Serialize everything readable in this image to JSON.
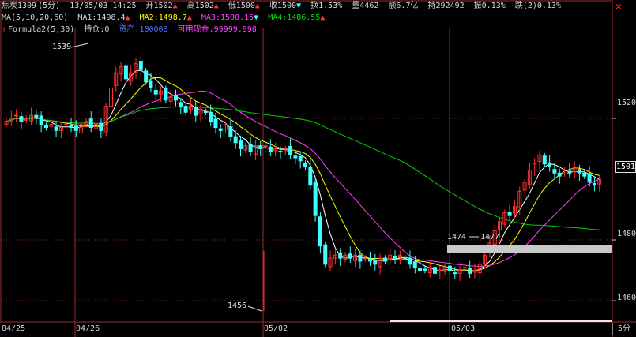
{
  "header": {
    "symbol": "焦炭1309",
    "period": "(5分)",
    "datetime": "13/05/03 14:25",
    "open": "开1502",
    "high": "高1502",
    "low": "低1500",
    "close": "收1500",
    "turnover_rate": "换1.53%",
    "volume": "量4462",
    "amount": "额6.7亿",
    "open_interest": "持292492",
    "amplitude": "振0.13%",
    "change": "跌(2)0.13%"
  },
  "ma_row": {
    "label": "MA(5,10,20,60)",
    "ma1": "MA1:1498.4",
    "ma2": "MA2:1498.7",
    "ma3": "MA3:1500.15",
    "ma4": "MA4:1486.55"
  },
  "formula_row": {
    "label": "Formula2(5,30)",
    "position": "持仓:0",
    "assets": "资产:100000",
    "cash": "可用现金:99999.998"
  },
  "y_axis": {
    "labels": [
      "1520",
      "1480",
      "1460"
    ],
    "current": "1501"
  },
  "x_axis": {
    "labels": [
      "04/25",
      "04/26",
      "05/02",
      "05/03"
    ],
    "period_button": "5分"
  },
  "annotations": {
    "high": "1539",
    "low": "1456",
    "level_a": "1474",
    "level_b": "1477"
  },
  "colors": {
    "up": "#ff3030",
    "down": "#40ffff",
    "ma5": "#ffffff",
    "ma10": "#ffff00",
    "ma20": "#ff40ff",
    "ma60": "#00d000",
    "grid": "#9b2b2b"
  },
  "chart_data": {
    "type": "line",
    "x_axis_labels": [
      "04/25",
      "04/26",
      "05/02",
      "05/03"
    ],
    "y_axis_ticks": [
      1520,
      1480,
      1460
    ],
    "ylim": [
      1453,
      1547
    ],
    "series": [
      {
        "name": "MA1",
        "last": 1498.4
      },
      {
        "name": "MA2",
        "last": 1498.7
      },
      {
        "name": "MA3",
        "last": 1500.15
      },
      {
        "name": "MA4",
        "last": 1486.55
      }
    ],
    "ohlc_close": [
      1519,
      1520,
      1521,
      1519,
      1520,
      1521,
      1520,
      1518,
      1517,
      1518,
      1516,
      1517,
      1518,
      1517,
      1516,
      1518,
      1519,
      1517,
      1518,
      1516,
      1524,
      1530,
      1535,
      1537,
      1533,
      1535,
      1538,
      1536,
      1532,
      1530,
      1528,
      1529,
      1526,
      1527,
      1526,
      1524,
      1522,
      1524,
      1521,
      1523,
      1522,
      1519,
      1517,
      1516,
      1518,
      1514,
      1512,
      1510,
      1511,
      1509,
      1511,
      1510,
      1511,
      1509,
      1510,
      1509,
      1510,
      1508,
      1507,
      1506,
      1504,
      1498,
      1488,
      1478,
      1472,
      1474,
      1475,
      1474,
      1475,
      1474,
      1475,
      1473,
      1474,
      1473,
      1472,
      1474,
      1473,
      1475,
      1474,
      1475,
      1474,
      1472,
      1471,
      1470,
      1470,
      1471,
      1469,
      1470,
      1471,
      1470,
      1469,
      1470,
      1471,
      1469,
      1470,
      1472,
      1475,
      1479,
      1483,
      1486,
      1489,
      1488,
      1491,
      1496,
      1499,
      1503,
      1505,
      1508,
      1505,
      1504,
      1502,
      1501,
      1503,
      1502,
      1504,
      1502,
      1501,
      1499,
      1498,
      1500
    ]
  }
}
